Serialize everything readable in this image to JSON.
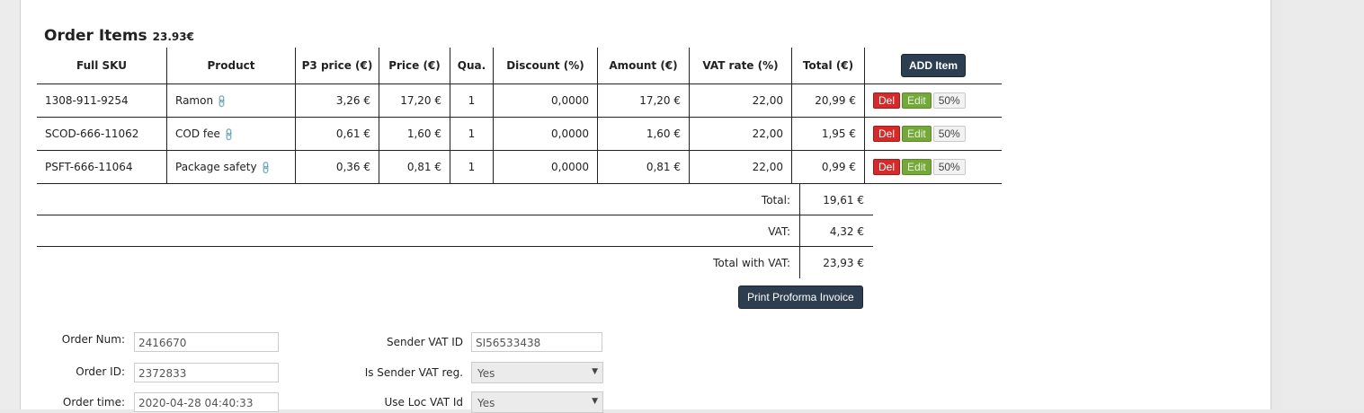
{
  "order_items": {
    "title": "Order Items",
    "total_badge": "23.93€",
    "headers": [
      "Full SKU",
      "Product",
      "P3 price (€)",
      "Price (€)",
      "Qua.",
      "Discount (%)",
      "Amount (€)",
      "VAT rate (%)",
      "Total (€)"
    ],
    "add_button": "ADD Item",
    "rows": [
      {
        "sku": "1308-911-9254",
        "product": "Ramon",
        "p3": "3,26 €",
        "price": "17,20 €",
        "qty": "1",
        "discount": "0,0000",
        "amount": "17,20 €",
        "vat": "22,00",
        "total": "20,99 €"
      },
      {
        "sku": "SCOD-666-11062",
        "product": "COD fee",
        "p3": "0,61 €",
        "price": "1,60 €",
        "qty": "1",
        "discount": "0,0000",
        "amount": "1,60 €",
        "vat": "22,00",
        "total": "1,95 €"
      },
      {
        "sku": "PSFT-666-11064",
        "product": "Package safety",
        "p3": "0,36 €",
        "price": "0,81 €",
        "qty": "1",
        "discount": "0,0000",
        "amount": "0,81 €",
        "vat": "22,00",
        "total": "0,99 €"
      }
    ],
    "row_actions": {
      "del": "Del",
      "edit": "Edit",
      "half": "50%"
    },
    "link_icon": "link-icon"
  },
  "totals": {
    "total_label": "Total:",
    "total_value": "19,61 €",
    "vat_label": "VAT:",
    "vat_value": "4,32 €",
    "total_vat_label": "Total with VAT:",
    "total_vat_value": "23,93 €"
  },
  "print_button": "Print Proforma Invoice",
  "form": {
    "order_num_label": "Order Num:",
    "order_num": "2416670",
    "order_id_label": "Order ID:",
    "order_id": "2372833",
    "order_time_label": "Order time:",
    "order_time": "2020-04-28 04:40:33",
    "sender_vat_label": "Sender VAT ID",
    "sender_vat": "SI56533438",
    "is_sender_vat_label": "Is Sender VAT reg.",
    "is_sender_vat": "Yes",
    "use_loc_vat_label": "Use Loc VAT Id",
    "use_loc_vat": "Yes"
  },
  "colors": {
    "dark_button": "#2c3e50",
    "del": "#d42a2a",
    "edit": "#74a83a"
  }
}
